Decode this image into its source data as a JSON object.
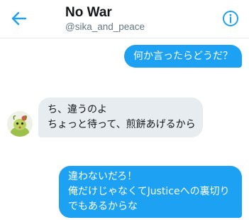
{
  "header": {
    "title": "No War",
    "handle": "@sika_and_peace"
  },
  "colors": {
    "accent": "#1da1f2",
    "incoming_bubble": "#e6ecf0"
  },
  "icons": {
    "back": "arrow-left-icon",
    "info": "info-icon"
  },
  "messages": [
    {
      "direction": "outgoing",
      "lines": [
        "何か言ったらどうだ？"
      ]
    },
    {
      "direction": "incoming",
      "lines": [
        "ち、違うのよ",
        "ちょっと待って、煎餅あげるから"
      ]
    },
    {
      "direction": "outgoing",
      "lines": [
        "違わないだろ！",
        "俺だけじゃなくてJusticeへの裏切り",
        "でもあるからな"
      ]
    }
  ]
}
